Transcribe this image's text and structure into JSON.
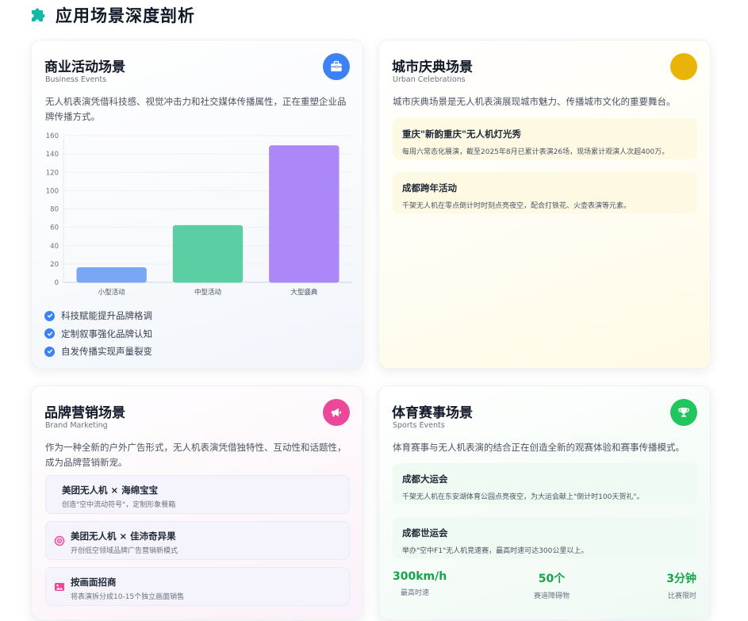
{
  "page": {
    "title": "应用场景深度剖析",
    "icon": "puzzle-icon"
  },
  "business": {
    "title": "商业活动场景",
    "subtitle": "Business Events",
    "icon": "briefcase-icon",
    "accent": "#3b82f6",
    "desc": "无人机表演凭借科技感、视觉冲击力和社交媒体传播属性，正在重塑企业品牌传播方式。",
    "checklist": [
      "科技赋能提升品牌格调",
      "定制叙事强化品牌认知",
      "自发传播实现声量裂变"
    ]
  },
  "chart_data": {
    "type": "bar",
    "categories": [
      "小型活动",
      "中型活动",
      "大型盛典"
    ],
    "values": [
      16,
      62,
      149
    ],
    "colors": [
      "#7aa7f5",
      "#5ccea3",
      "#ab87f7"
    ],
    "ylim": [
      0,
      160
    ],
    "yticks": [
      0,
      20,
      40,
      60,
      80,
      100,
      120,
      140,
      160
    ],
    "grid": true,
    "legend": "none"
  },
  "urban": {
    "title": "城市庆典场景",
    "subtitle": "Urban Celebrations",
    "accent": "#eab308",
    "desc": "城市庆典场景是无人机表演展现城市魅力、传播城市文化的重要舞台。",
    "events": [
      {
        "title": "重庆\"新韵重庆\"无人机灯光秀",
        "desc": "每周六常态化展演，截至2025年8月已累计表演26场，现场累计观演人次超400万。"
      },
      {
        "title": "成都跨年活动",
        "desc": "千架无人机在零点倒计时时刻点亮夜空，配合打铁花、火壶表演等元素。"
      }
    ]
  },
  "brand": {
    "title": "品牌营销场景",
    "subtitle": "Brand Marketing",
    "icon": "megaphone-icon",
    "accent": "#ec4899",
    "desc": "作为一种全新的户外广告形式，无人机表演凭借独特性、互动性和话题性，成为品牌营销新宠。",
    "items": [
      {
        "title": "美团无人机 × 海绵宝宝",
        "desc": "创造\"空中流动符号\"，定制形象餐箱",
        "icon": ""
      },
      {
        "title": "美团无人机 × 佳沛奇异果",
        "desc": "开创低空领域品牌广告营销新模式",
        "icon": "target-icon"
      },
      {
        "title": "按画面招商",
        "desc": "将表演拆分成10-15个独立画面销售",
        "icon": "image-icon"
      }
    ]
  },
  "sports": {
    "title": "体育赛事场景",
    "subtitle": "Sports Events",
    "icon": "trophy-icon",
    "accent": "#22c55e",
    "desc": "体育赛事与无人机表演的结合正在创造全新的观赛体验和赛事传播模式。",
    "events": [
      {
        "title": "成都大运会",
        "desc": "千架无人机在东安湖体育公园点亮夜空，为大运会献上\"倒计时100天贺礼\"。"
      },
      {
        "title": "成都世运会",
        "desc": "举办\"空中F1\"无人机竞速赛，最高时速可达300公里以上。"
      }
    ],
    "stats": [
      {
        "value": "300km/h",
        "label": "最高时速"
      },
      {
        "value": "50个",
        "label": "赛道障碍物"
      },
      {
        "value": "3分钟",
        "label": "比赛限时"
      }
    ]
  }
}
